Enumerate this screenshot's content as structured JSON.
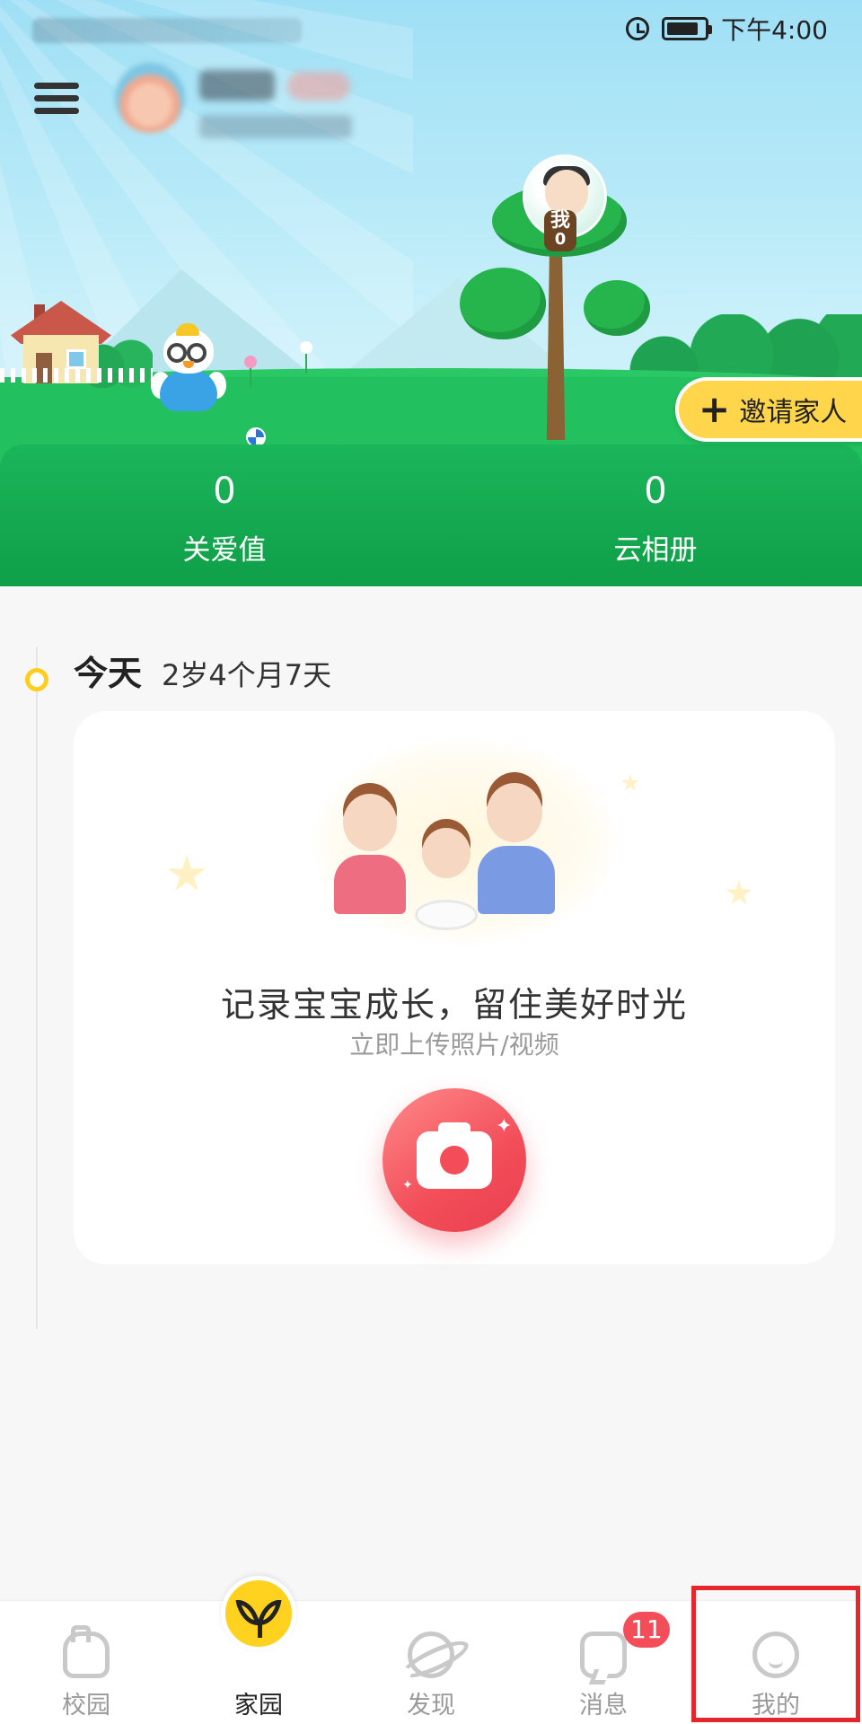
{
  "status_bar": {
    "time": "下午4:00",
    "icons": [
      "alarm-icon",
      "battery-icon"
    ]
  },
  "header": {
    "menu_icon": "menu-icon",
    "profile_avatar": "avatar"
  },
  "hero": {
    "tree_tag": "我",
    "tree_count": "0",
    "invite_label": "邀请家人",
    "invite_icon": "plus-icon"
  },
  "stats": [
    {
      "value": "0",
      "label": "关爱值"
    },
    {
      "value": "0",
      "label": "云相册"
    }
  ],
  "timeline": {
    "today_label": "今天",
    "age": "2岁4个月7天"
  },
  "card": {
    "title": "记录宝宝成长，留住美好时光",
    "subtitle": "立即上传照片/视频",
    "camera_icon": "camera-icon"
  },
  "bottom_nav": {
    "items": [
      {
        "label": "校园",
        "icon": "school-icon",
        "active": false
      },
      {
        "label": "家园",
        "icon": "sprout-icon",
        "active": true
      },
      {
        "label": "发现",
        "icon": "planet-icon",
        "active": false
      },
      {
        "label": "消息",
        "icon": "message-icon",
        "active": false,
        "badge": "11"
      },
      {
        "label": "我的",
        "icon": "smiley-icon",
        "active": false
      }
    ]
  },
  "colors": {
    "accent_yellow": "#ffd21f",
    "green": "#22c05f",
    "camera_red": "#f24d59",
    "highlight_red": "#e5262d"
  }
}
